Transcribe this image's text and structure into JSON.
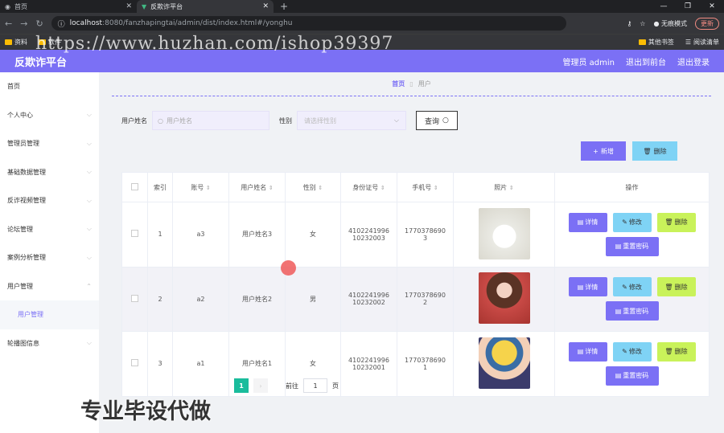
{
  "browser": {
    "tabs": [
      {
        "title": "首页",
        "active": false
      },
      {
        "title": "反欺诈平台",
        "active": true
      }
    ],
    "url_host": "localhost",
    "url_path": ":8080/fanzhapingtai/admin/dist/index.html#/yonghu",
    "incognito_label": "无痕模式",
    "update_label": "更新",
    "bookmarks": [
      "资料",
      "软件"
    ],
    "bookmarks_right": [
      "其他书签",
      "阅读清单"
    ]
  },
  "watermark": "https://www.huzhan.com/ishop39397",
  "header": {
    "title": "反欺诈平台",
    "user": "管理员 admin",
    "back_front": "退出到前台",
    "logout": "退出登录",
    "accent": "#7b70f5"
  },
  "sidebar": {
    "items": [
      {
        "label": "首页",
        "has_arrow": false
      },
      {
        "label": "个人中心",
        "has_arrow": true
      },
      {
        "label": "管理员管理",
        "has_arrow": true
      },
      {
        "label": "基础数据管理",
        "has_arrow": true
      },
      {
        "label": "反诈视频管理",
        "has_arrow": true
      },
      {
        "label": "论坛管理",
        "has_arrow": true
      },
      {
        "label": "案例分析管理",
        "has_arrow": true
      },
      {
        "label": "用户管理",
        "has_arrow": true,
        "expanded": true
      },
      {
        "label": "用户管理",
        "sub": true
      },
      {
        "label": "轮播图信息",
        "has_arrow": true
      }
    ]
  },
  "breadcrumb": {
    "home": "首页",
    "current": "用户"
  },
  "search": {
    "name_label": "用户姓名",
    "name_placeholder": "用户姓名",
    "gender_label": "性别",
    "gender_placeholder": "请选择性别",
    "query_label": "查询"
  },
  "actions": {
    "add": "新增",
    "delete": "删除"
  },
  "table": {
    "headers": [
      "索引",
      "账号",
      "用户姓名",
      "性别",
      "身份证号",
      "手机号",
      "照片",
      "操作"
    ],
    "rows": [
      {
        "index": "1",
        "account": "a3",
        "name": "用户姓名3",
        "gender": "女",
        "id_line1": "4102241996",
        "id_line2": "10232003",
        "phone_line1": "1770378690",
        "phone_line2": "3"
      },
      {
        "index": "2",
        "account": "a2",
        "name": "用户姓名2",
        "gender": "男",
        "id_line1": "4102241996",
        "id_line2": "10232002",
        "phone_line1": "1770378690",
        "phone_line2": "2"
      },
      {
        "index": "3",
        "account": "a1",
        "name": "用户姓名1",
        "gender": "女",
        "id_line1": "4102241996",
        "id_line2": "10232001",
        "phone_line1": "1770378690",
        "phone_line2": "1"
      }
    ],
    "ops": {
      "detail": "详情",
      "edit": "修改",
      "delete": "删除",
      "reset": "重置密码"
    }
  },
  "pagination": {
    "current": "1",
    "goto": "前往",
    "page_value": "1",
    "page_unit": "页"
  },
  "promo": "专业毕设代做"
}
